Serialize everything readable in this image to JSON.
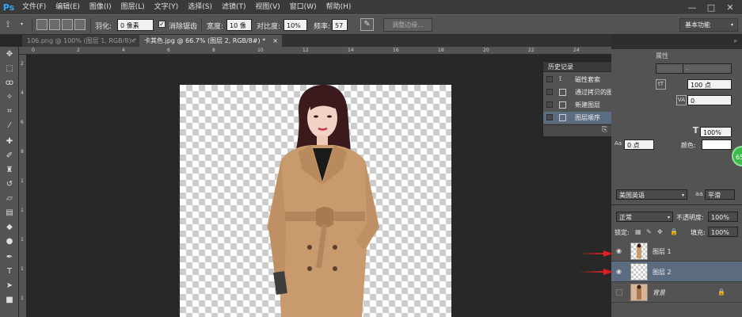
{
  "app": {
    "logo": "Ps",
    "window_controls": [
      "—",
      "□",
      "✕"
    ]
  },
  "menu": [
    "文件(F)",
    "编辑(E)",
    "图像(I)",
    "图层(L)",
    "文字(Y)",
    "选择(S)",
    "滤镜(T)",
    "视图(V)",
    "窗口(W)",
    "帮助(H)"
  ],
  "options": {
    "feather_label": "羽化:",
    "feather_value": "0 像素",
    "antialias_label": "消除锯齿",
    "antialias_checked": "✓",
    "width_label": "宽度:",
    "width_value": "10 像素",
    "contrast_label": "对比度:",
    "contrast_value": "10%",
    "frequency_label": "频率:",
    "frequency_value": "57",
    "refine_edge": "调整边缘...",
    "workspace": "基本功能"
  },
  "tabs": [
    {
      "label": "106.png @ 100% (图层 1, RGB/8) *",
      "close": "×",
      "active": false
    },
    {
      "label": "卡其色.jpg @ 66.7% (图层 2, RGB/8#) *",
      "close": "×",
      "active": true
    }
  ],
  "rulers": {
    "top": [
      "0",
      "2",
      "4",
      "6",
      "8",
      "10",
      "12",
      "14",
      "16",
      "18",
      "20",
      "22",
      "24"
    ],
    "left": [
      "2",
      "4",
      "6",
      "8",
      "1",
      "1",
      "1",
      "1",
      "1"
    ]
  },
  "history": {
    "title": "历史记录",
    "items": [
      {
        "label": "磁性套索",
        "selected": false
      },
      {
        "label": "通过拷贝的图层",
        "selected": false
      },
      {
        "label": "新建图层",
        "selected": false
      },
      {
        "label": "图层顺序",
        "selected": true
      }
    ]
  },
  "character": {
    "tab_label": "属性",
    "font_size": "100 点",
    "tracking": "0",
    "leading": "-",
    "vscale": "100%",
    "baseline": "0 点",
    "color_label": "颜色:",
    "styles": [
      "T",
      "T",
      "TT",
      "Tr",
      "T'",
      "T,",
      "T",
      "T"
    ],
    "language": "美国英语",
    "aa_prefix": "aa",
    "antialias_mode": "平滑"
  },
  "layers": {
    "blend_mode": "正常",
    "opacity_label": "不透明度:",
    "opacity": "100%",
    "lock_label": "锁定:",
    "fill_label": "填充:",
    "fill": "100%",
    "items": [
      {
        "name": "图层 1",
        "visible": "◉",
        "selected": false
      },
      {
        "name": "图层 2",
        "visible": "◉",
        "selected": true
      },
      {
        "name": "背景",
        "visible": "",
        "selected": false,
        "lock": "🔒"
      }
    ]
  },
  "badge": "65",
  "colors": {
    "accent": "#31a8ff",
    "selected_row": "#5b6b80",
    "arrow": "#e02020",
    "coat": "#c89a6e",
    "badge": "#3dbb4a"
  }
}
